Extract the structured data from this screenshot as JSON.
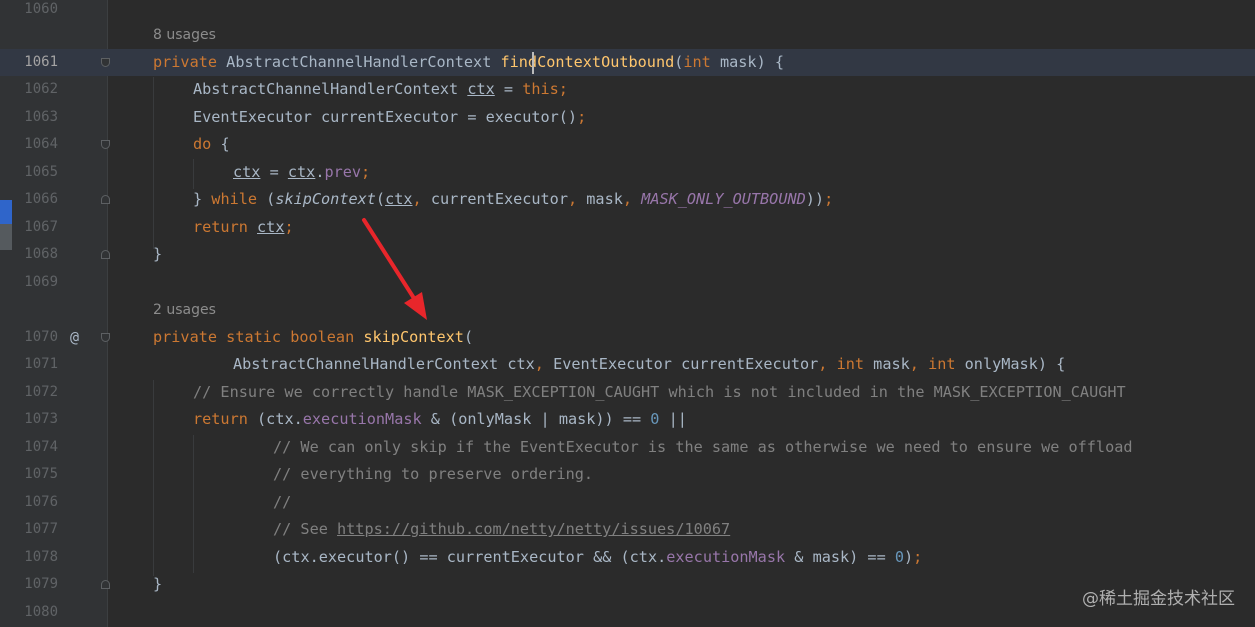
{
  "editor": {
    "usages_1": "8 usages",
    "usages_2": "2 usages",
    "line_numbers": [
      "1060",
      "1061",
      "1062",
      "1063",
      "1064",
      "1065",
      "1066",
      "1067",
      "1068",
      "1069",
      "1070",
      "1071",
      "1072",
      "1073",
      "1074",
      "1075",
      "1076",
      "1077",
      "1078",
      "1079",
      "1080"
    ],
    "current_line": "1061",
    "tokens": {
      "private": "private",
      "static": "static",
      "boolean": "boolean",
      "int": "int",
      "this": "this",
      "do": "do",
      "while": "while",
      "return": "return",
      "type_ahc": "AbstractChannelHandlerContext",
      "type_ee": "EventExecutor",
      "fn_find": "findContextOutbound",
      "fn_skip": "skipContext",
      "fn_executor": "executor",
      "var_ctx": "ctx",
      "var_mask": "mask",
      "var_only_mask": "onlyMask",
      "var_current_executor": "currentExecutor",
      "field_prev": "prev",
      "field_execution_mask": "executionMask",
      "const_mask_only_outbound": "MASK_ONLY_OUTBOUND",
      "num_zero": "0"
    },
    "comments": {
      "c1072": "// Ensure we correctly handle MASK_EXCEPTION_CAUGHT which is not included in the MASK_EXCEPTION_CAUGHT",
      "c1074": "// We can only skip if the EventExecutor is the same as otherwise we need to ensure we offload",
      "c1075": "// everything to preserve ordering.",
      "c1076": "//",
      "c1077_prefix": "// See ",
      "c1077_link": "https://github.com/netty/netty/issues/10067"
    },
    "gutter_at_symbol": "@"
  },
  "watermark": "@稀土掘金技术社区",
  "colors": {
    "background": "#2b2b2b",
    "gutter": "#313335",
    "keyword": "#cc7832",
    "function": "#ffc66d",
    "field": "#9876aa",
    "number": "#6897bb",
    "comment": "#808080",
    "text": "#a9b7c6",
    "arrow": "#e8262b"
  }
}
